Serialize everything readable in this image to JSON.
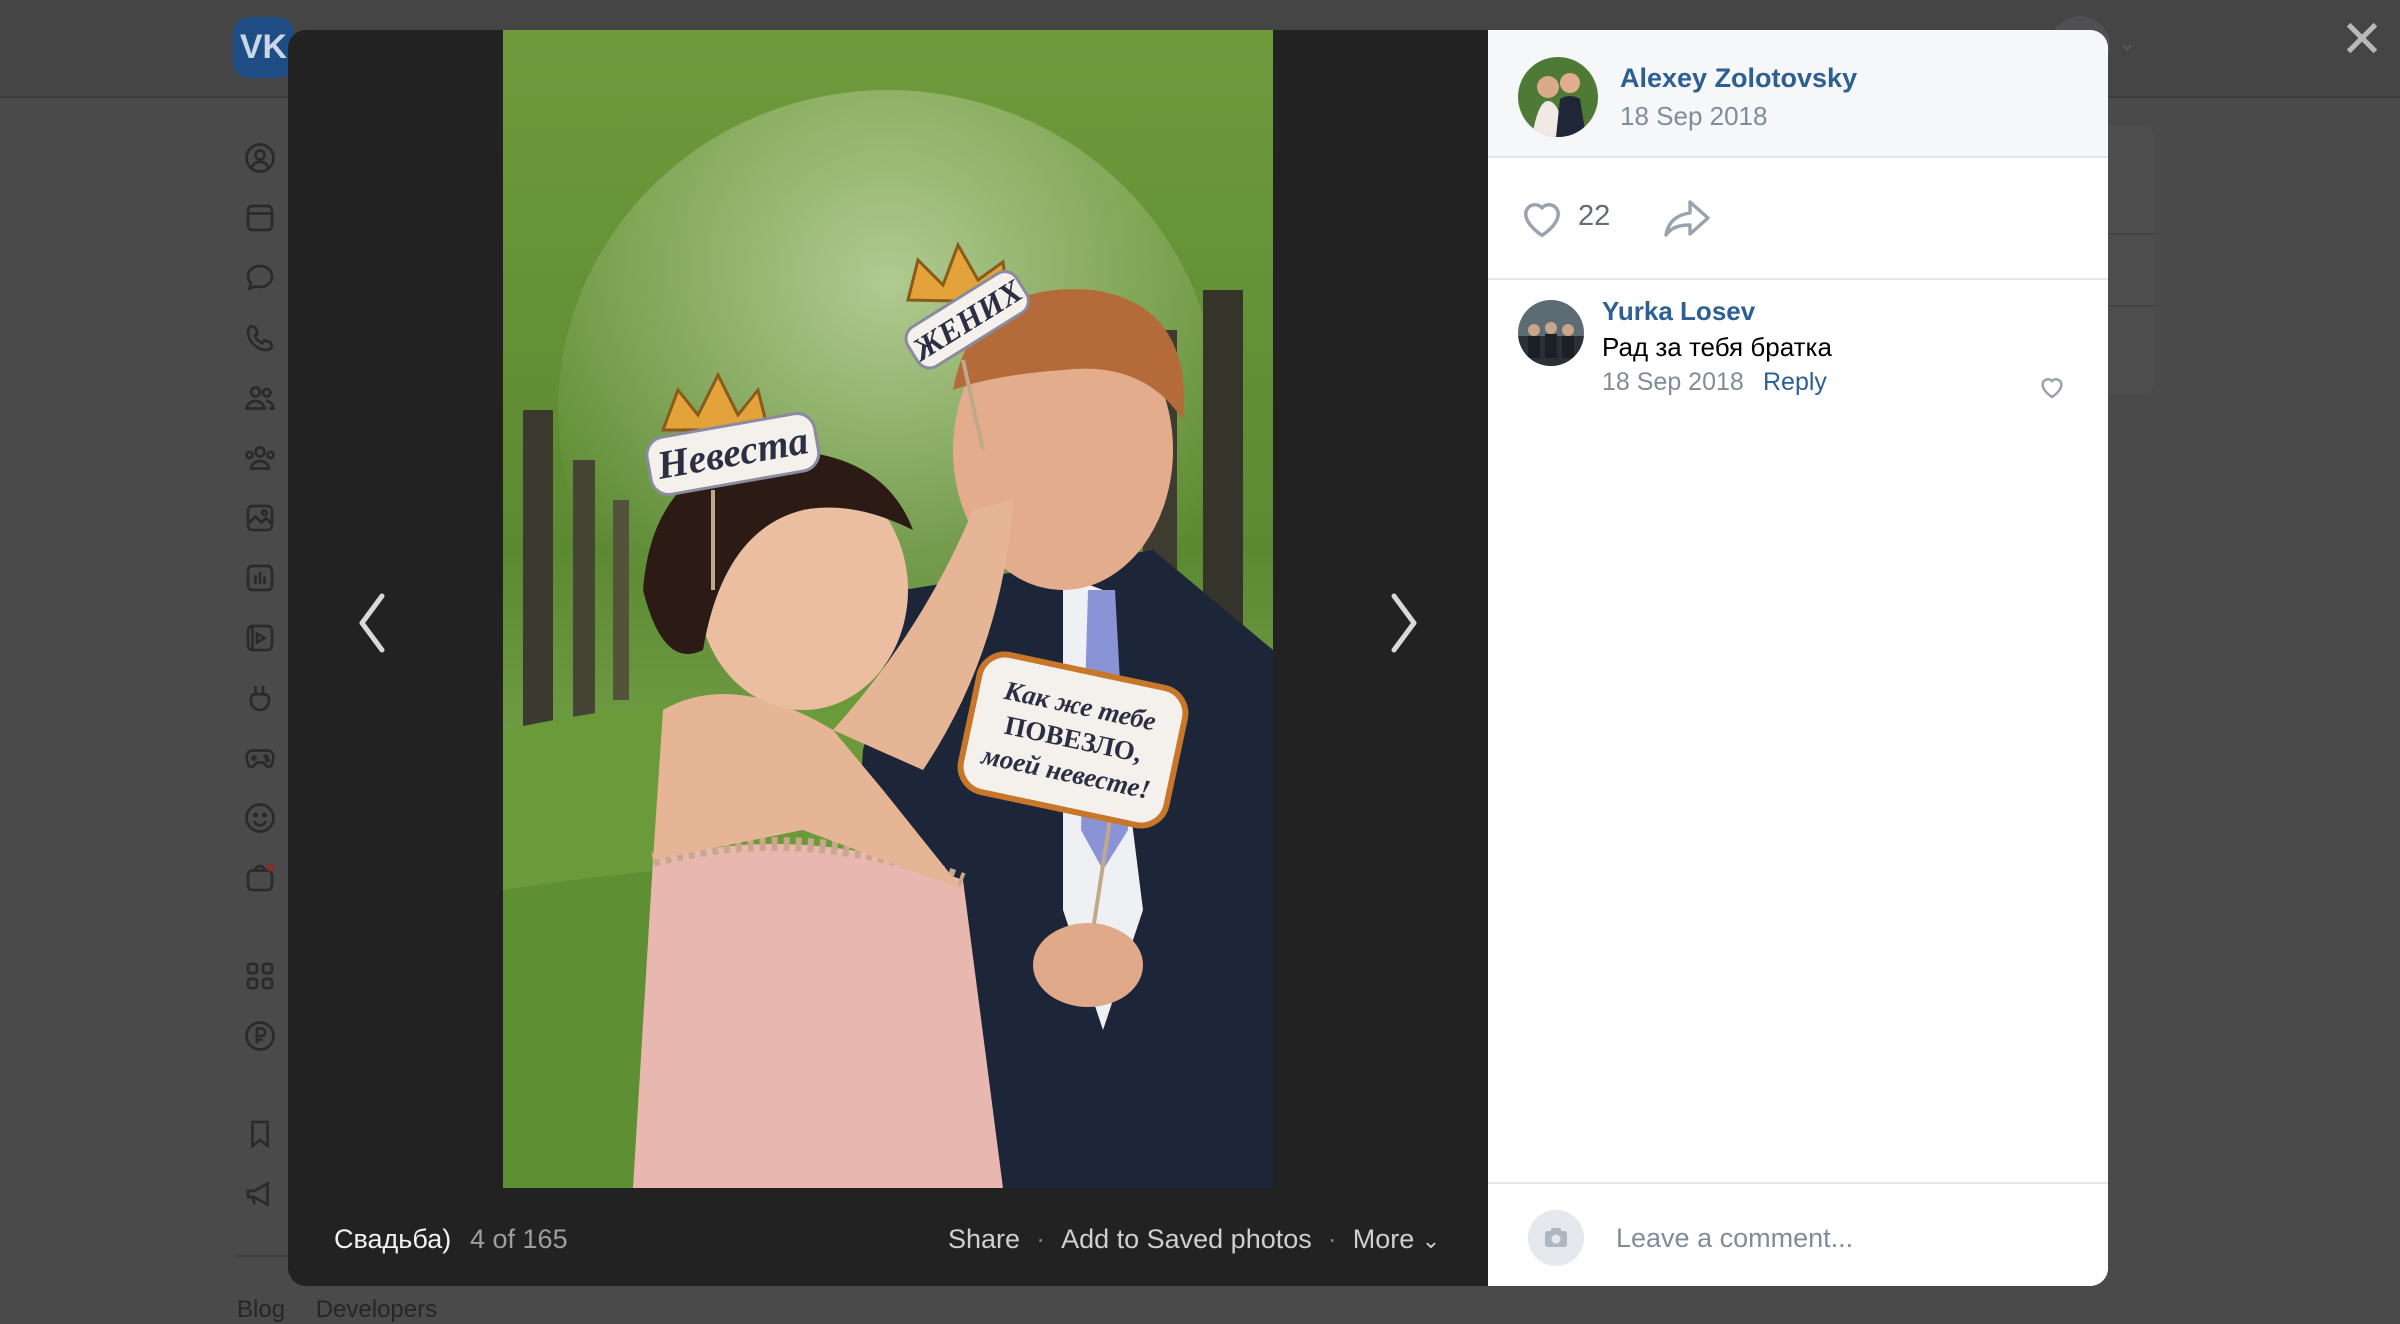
{
  "colors": {
    "link": "#2d5f93",
    "secondary_text": "#818c99",
    "panel_bg": "#ffffff",
    "photo_bg": "#222223",
    "overlay_bg": "#4a4a4b"
  },
  "background_page": {
    "logo_text": "VK",
    "nav_icons": [
      "profile-icon",
      "news-icon",
      "messenger-icon",
      "calls-icon",
      "friends-icon",
      "communities-icon",
      "photos-icon",
      "music-icon",
      "video-icon",
      "clips-icon",
      "games-icon",
      "stickers-icon",
      "market-icon",
      "services-icon",
      "payments-icon",
      "bookmarks-icon",
      "ads-icon"
    ],
    "footer_links": [
      "Blog",
      "Developers"
    ]
  },
  "viewer": {
    "close_icon": "close-icon",
    "prev_icon": "chevron-left-icon",
    "next_icon": "chevron-right-icon",
    "album_title": "Свадьба)",
    "counter": "4 of 165",
    "actions": {
      "share": "Share",
      "save": "Add to Saved photos",
      "more": "More"
    },
    "photo": {
      "sign_bride": "Невеста",
      "sign_groom": "ЖЕНИХ",
      "sign_quote_line1": "Как же тебе",
      "sign_quote_line2": "ПОВЕЗЛО,",
      "sign_quote_line3": "моей невесте!"
    }
  },
  "panel": {
    "author_name": "Alexey Zolotovsky",
    "author_date": "18 Sep 2018",
    "likes_count": "22",
    "comments": [
      {
        "author": "Yurka Losev",
        "text": "Рад за тебя братка",
        "date": "18 Sep 2018",
        "reply_label": "Reply"
      }
    ],
    "comment_placeholder": "Leave a comment..."
  }
}
